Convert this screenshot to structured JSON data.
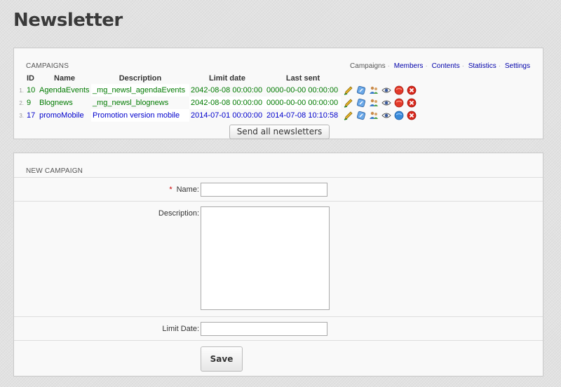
{
  "page": {
    "title": "Newsletter"
  },
  "campaigns": {
    "section_title": "CAMPAIGNS",
    "nav": [
      {
        "label": "Campaigns",
        "current": true
      },
      {
        "label": "Members",
        "current": false
      },
      {
        "label": "Contents",
        "current": false
      },
      {
        "label": "Statistics",
        "current": false
      },
      {
        "label": "Settings",
        "current": false
      }
    ],
    "columns": {
      "id": "ID",
      "name": "Name",
      "description": "Description",
      "limit_date": "Limit date",
      "last_sent": "Last sent"
    },
    "rows": [
      {
        "num": "1.",
        "id": "10",
        "name": "AgendaEvents",
        "description": "_mg_newsl_agendaEvents",
        "limit_date": "2042-08-08 00:00:00",
        "last_sent": "0000-00-00 00:00:00",
        "color": "green",
        "status": "red"
      },
      {
        "num": "2.",
        "id": "9",
        "name": "Blognews",
        "description": "_mg_newsl_blognews",
        "limit_date": "2042-08-08 00:00:00",
        "last_sent": "0000-00-00 00:00:00",
        "color": "green",
        "status": "red"
      },
      {
        "num": "3.",
        "id": "17",
        "name": "promoMobile",
        "description": "Promotion version mobile",
        "limit_date": "2014-07-01 00:00:00",
        "last_sent": "2014-07-08 10:10:58",
        "color": "blue",
        "status": "blue"
      }
    ],
    "send_all_label": "Send all newsletters"
  },
  "new_campaign": {
    "section_title": "NEW CAMPAIGN",
    "name_label": "Name:",
    "required_mark": "*",
    "name_value": "",
    "description_label": "Description:",
    "description_value": "",
    "limit_date_label": "Limit Date:",
    "limit_date_value": "",
    "save_label": "Save"
  },
  "colors": {
    "active_text": "#007a00",
    "inactive_text": "#0000cc",
    "link": "#0000aa"
  }
}
